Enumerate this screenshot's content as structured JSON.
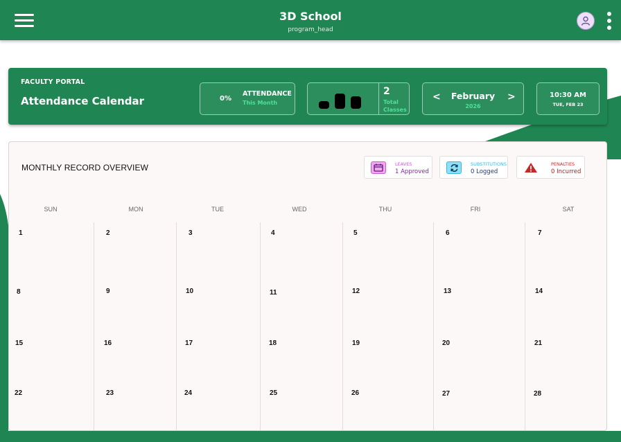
{
  "app": {
    "title": "3D School",
    "role": "program_head"
  },
  "icons": {
    "menu": "hamburger-menu-icon",
    "profile": "user-avatar-icon",
    "more": "vertical-dots-icon",
    "leaves": "calendar-icon",
    "substitutions": "refresh-icon",
    "penalties": "warning-triangle-icon"
  },
  "colors": {
    "brand_green": "#1f8653",
    "accent_green": "#4fe09a",
    "leaves": "#b24ac9",
    "substitutions": "#36b7e3",
    "penalties": "#c62828"
  },
  "header": {
    "portal_label": "FACULTY PORTAL",
    "page_title": "Attendance Calendar",
    "attendance": {
      "percent": "0%",
      "label": "ATTENDANCE",
      "sublabel": "This Month"
    },
    "classes": {
      "bar_levels": [
        0.45,
        0.92,
        0.75
      ],
      "count": "2",
      "label": "Total Classes"
    },
    "month": {
      "prev": "<",
      "name": "February",
      "year": "2026",
      "next": ">"
    },
    "time": {
      "clock": "10:30 AM",
      "date": "TUE, FEB 23"
    }
  },
  "overview": {
    "title": "MONTHLY RECORD OVERVIEW",
    "stats": [
      {
        "label": "LEAVES",
        "value": "1 Approved"
      },
      {
        "label": "SUBSTITUTIONS",
        "value": "0 Logged"
      },
      {
        "label": "PENALTIES",
        "value": "0 Incurred"
      }
    ]
  },
  "calendar": {
    "weekdays": [
      "SUN",
      "MON",
      "TUE",
      "WED",
      "THU",
      "FRI",
      "SAT"
    ],
    "weeks": [
      [
        "1",
        "2",
        "3",
        "4",
        "5",
        "6",
        "7"
      ],
      [
        "8",
        "9",
        "10",
        "11",
        "12",
        "13",
        "14"
      ],
      [
        "15",
        "16",
        "17",
        "18",
        "19",
        "20",
        "21"
      ],
      [
        "22",
        "23",
        "24",
        "25",
        "26",
        "27",
        "28"
      ]
    ]
  }
}
